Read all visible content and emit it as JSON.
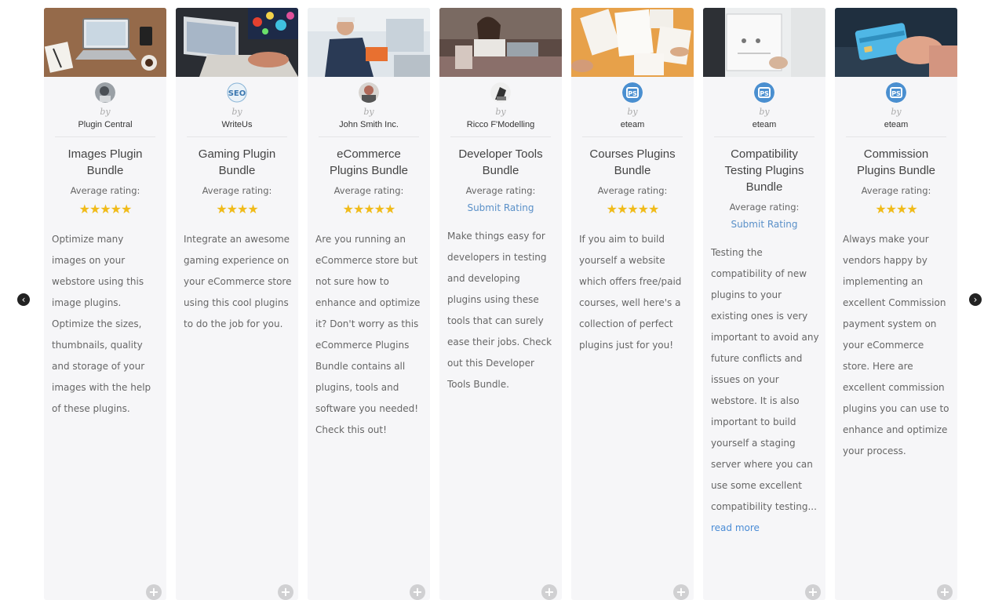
{
  "nav": {
    "prev_icon": "chevron-left-icon",
    "next_icon": "chevron-right-icon"
  },
  "colors": {
    "star": "#f0bb1a",
    "link": "#5a90c8",
    "card_bg": "#f6f6f8"
  },
  "cards": [
    {
      "by": "by",
      "vendor": "Plugin Central",
      "title": "Images Plugin Bundle",
      "avg_label": "Average rating:",
      "rating": 5,
      "stars": "★★★★★",
      "description": "Optimize many images on your webstore using this image plugins. Optimize the sizes, thumbnails, quality and storage of your images with the help of these plugins."
    },
    {
      "by": "by",
      "vendor": "WriteUs",
      "title": "Gaming Plugin Bundle",
      "avg_label": "Average rating:",
      "rating": 4,
      "stars": "★★★★",
      "description": "Integrate an awesome gaming experience on your eCommerce store using this cool plugins to do the job for you."
    },
    {
      "by": "by",
      "vendor": "John Smith Inc.",
      "title": "eCommerce Plugins Bundle",
      "avg_label": "Average rating:",
      "rating": 5,
      "stars": "★★★★★",
      "description": "Are you running an eCommerce store but not sure how to enhance and optimize it? Don't worry as this eCommerce Plugins Bundle contains all plugins, tools and software you needed! Check this out!"
    },
    {
      "by": "by",
      "vendor": "Ricco F'Modelling",
      "title": "Developer Tools Bundle",
      "avg_label": "Average rating:",
      "submit": "Submit Rating",
      "description": "Make things easy for developers in testing and developing plugins using these tools that can surely ease their jobs. Check out this Developer Tools Bundle."
    },
    {
      "by": "by",
      "vendor": "eteam",
      "title": "Courses Plugins Bundle",
      "avg_label": "Average rating:",
      "rating": 5,
      "stars": "★★★★★",
      "description": "If you aim to build yourself a website which offers free/paid courses, well here's a collection of perfect plugins just for you!"
    },
    {
      "by": "by",
      "vendor": "eteam",
      "title": "Compatibility Testing Plugins Bundle",
      "avg_label": "Average rating:",
      "submit": "Submit Rating",
      "description": "Testing the compatibility of new plugins to your existing ones is very important to avoid any future conflicts and issues on your webstore. It is also important to build yourself a staging server where you can use some excellent compatibility testing...",
      "read_more": "read more"
    },
    {
      "by": "by",
      "vendor": "eteam",
      "title": "Commission Plugins Bundle",
      "avg_label": "Average rating:",
      "rating": 4,
      "stars": "★★★★",
      "description": "Always make your vendors happy by implementing an excellent Commission payment system on your eCommerce store. Here are excellent commission plugins you can use to enhance and optimize your process."
    }
  ]
}
